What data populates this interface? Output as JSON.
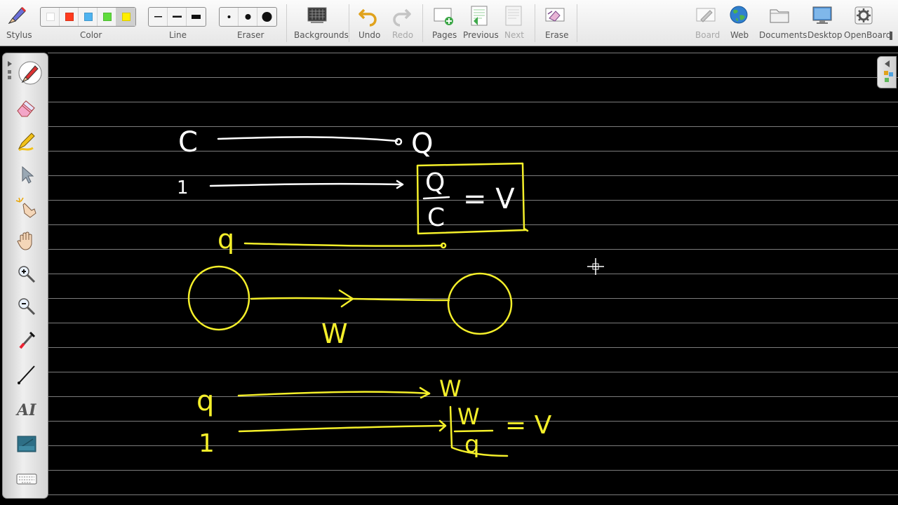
{
  "toolbar": {
    "stylus": "Stylus",
    "color": "Color",
    "line": "Line",
    "eraser": "Eraser",
    "backgrounds": "Backgrounds",
    "undo": "Undo",
    "redo": "Redo",
    "pages": "Pages",
    "previous": "Previous",
    "next": "Next",
    "erase": "Erase",
    "board": "Board",
    "web": "Web",
    "documents": "Documents",
    "desktop": "Desktop",
    "openboard": "OpenBoard"
  },
  "colors": {
    "swatches": [
      "#ffffff",
      "#ff3b1e",
      "#4fb3f0",
      "#5fdc3c",
      "#ffee00"
    ],
    "selected_index": 4,
    "ink_white": "#ffffff",
    "ink_yellow": "#f4ef2a",
    "board_background": "#000000",
    "rule_lines": "#7c7c7c"
  },
  "line_widths": {
    "options": [
      "thin",
      "medium",
      "thick"
    ],
    "selected_index": null
  },
  "eraser_sizes": {
    "options": [
      "small",
      "medium",
      "large"
    ],
    "selected_index": null
  },
  "palette": {
    "tools": [
      "pen-icon",
      "eraser-icon",
      "marker-icon",
      "selector-icon",
      "interact-icon",
      "hand-icon",
      "zoom-in-icon",
      "zoom-out-icon",
      "laser-pointer-icon",
      "line-icon",
      "text-icon",
      "capture-icon",
      "keyboard-icon"
    ],
    "selected": "pen-icon",
    "text_tool_label": "AI"
  },
  "board": {
    "handwriting": {
      "line1_left": "C",
      "line1_right": "Q",
      "line2_left": "1",
      "box_numerator": "Q",
      "box_denominator": "C",
      "box_equals": "= V",
      "line3_left": "q",
      "arrow_label": "W",
      "line4_left": "q",
      "line4_right": "W",
      "line5_left": "1",
      "frac_numerator": "W",
      "frac_denominator": "q",
      "frac_equals": "= V"
    }
  }
}
